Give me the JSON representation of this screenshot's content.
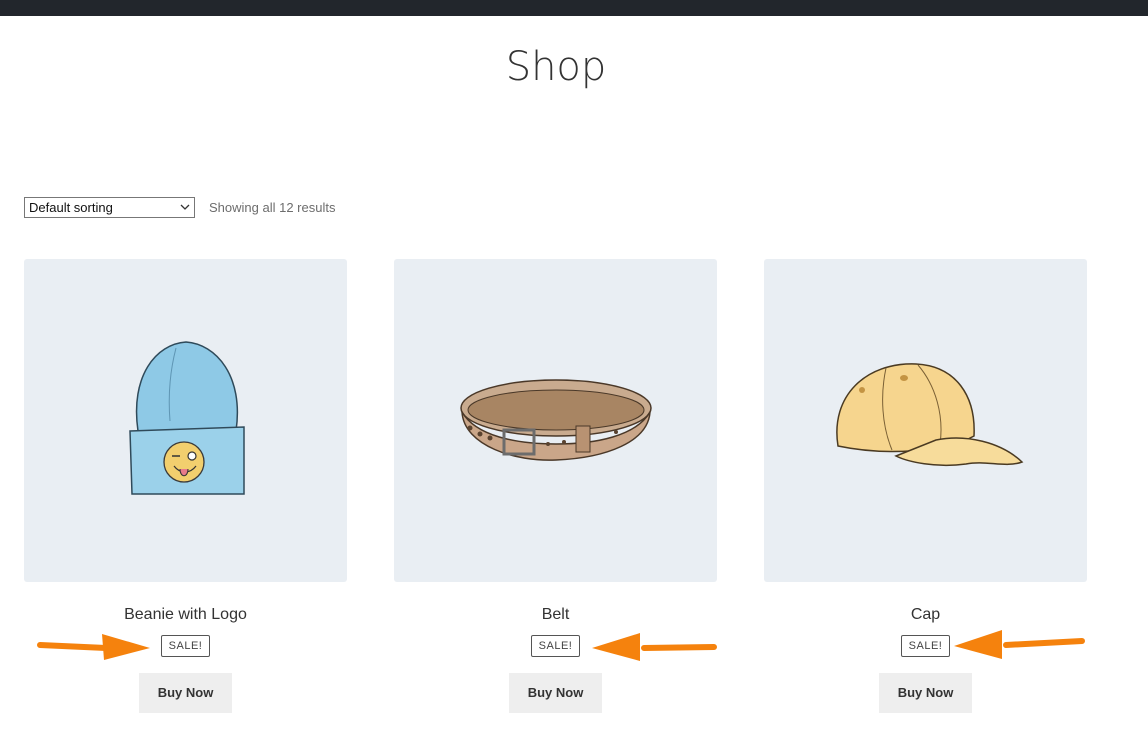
{
  "page": {
    "title": "Shop"
  },
  "toolbar": {
    "sort_value": "Default sorting",
    "result_count": "Showing all 12 results"
  },
  "products": [
    {
      "name": "Beanie with Logo",
      "badge": "SALE!",
      "button": "Buy Now",
      "image_icon": "beanie-icon"
    },
    {
      "name": "Belt",
      "badge": "SALE!",
      "button": "Buy Now",
      "image_icon": "belt-icon"
    },
    {
      "name": "Cap",
      "badge": "SALE!",
      "button": "Buy Now",
      "image_icon": "cap-icon"
    }
  ],
  "colors": {
    "topbar": "#22262c",
    "image_bg": "#e9eef3",
    "annotation_arrow": "#f5820d",
    "button_bg": "#eeeeee"
  }
}
